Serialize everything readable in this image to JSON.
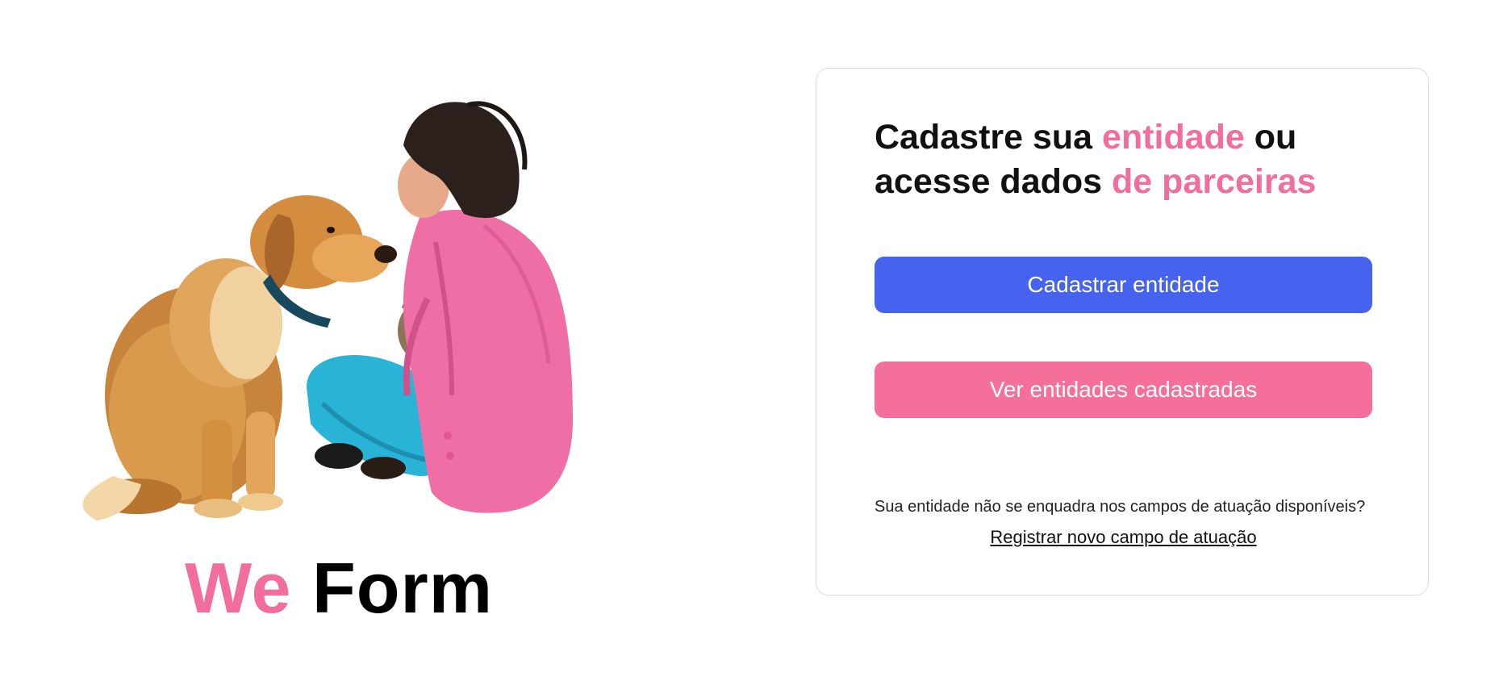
{
  "brand": {
    "word1": "We",
    "word2": "Form",
    "word1_color": "#f06d9c",
    "word2_color": "#000000"
  },
  "card": {
    "title_part1": "Cadastre sua ",
    "title_accent1": "entidade",
    "title_part2": " ou",
    "title_part3": "acesse dados ",
    "title_accent2": "de parceiras",
    "accent_color": "#f06d9c"
  },
  "actions": {
    "primary_label": "Cadastrar entidade",
    "primary_color": "#4663f0",
    "secondary_label": "Ver entidades cadastradas",
    "secondary_color": "#f56f9b"
  },
  "footer": {
    "help_text": "Sua entidade não se enquadra nos campos de atuação disponíveis?",
    "link_label": "Registrar novo campo de atuação"
  },
  "illustration": {
    "icon": "woman-with-dog-and-cat-illustration"
  }
}
